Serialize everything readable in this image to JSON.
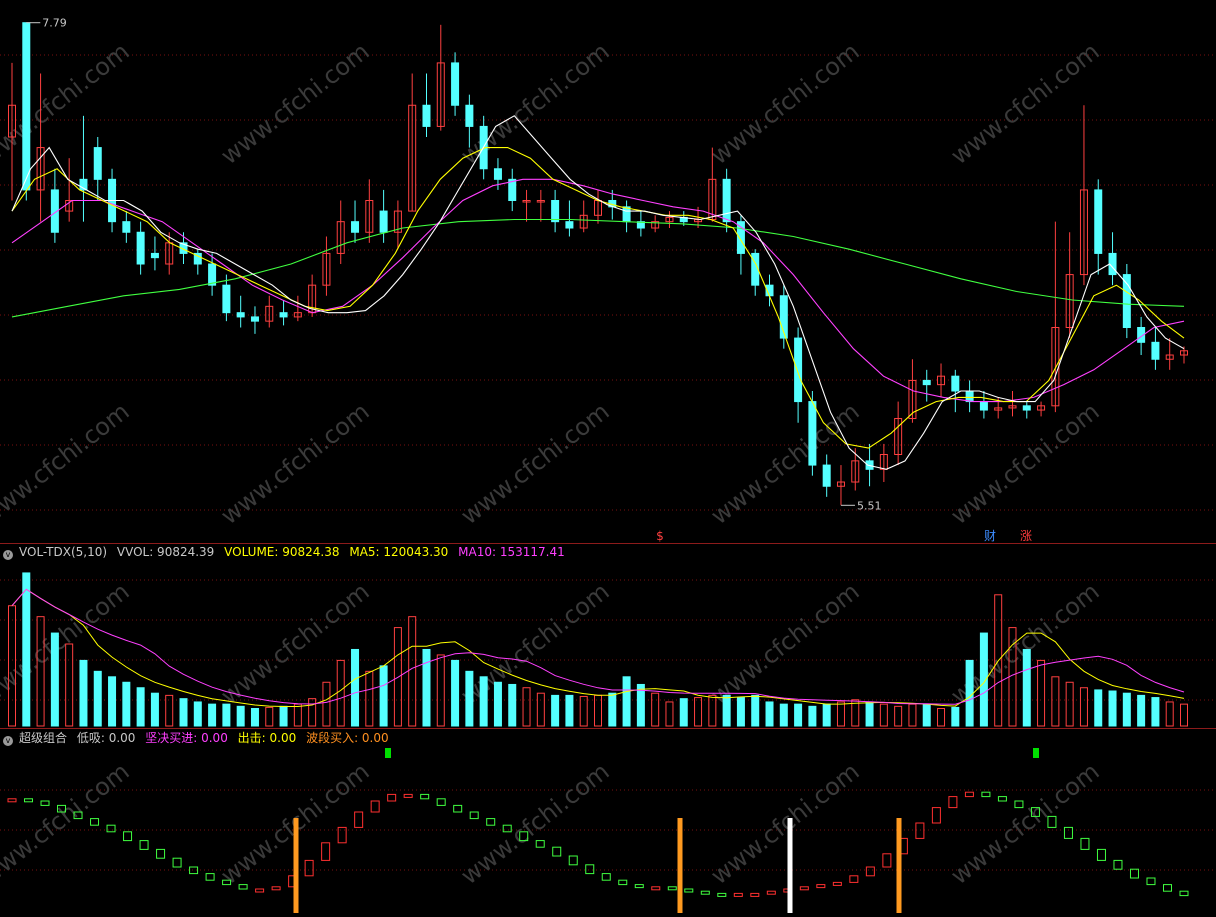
{
  "main_panel": {
    "high_label": "7.79",
    "low_label": "5.51",
    "markers": [
      {
        "text": "$",
        "color": "#ff4040"
      },
      {
        "text": "财",
        "color": "#3c8cff"
      },
      {
        "text": "涨",
        "color": "#ff3c3c"
      }
    ],
    "watermark": "www.cfchi.com"
  },
  "volume_panel": {
    "name": "VOL-TDX(5,10)",
    "items": [
      {
        "label": "VVOL: 90824.39",
        "color": "#c8c8c8"
      },
      {
        "label": "VOLUME: 90824.38",
        "color": "#ffff00"
      },
      {
        "label": "MA5: 120043.30",
        "color": "#ffff00"
      },
      {
        "label": "MA10: 153117.41",
        "color": "#ff40ff"
      }
    ]
  },
  "indicator_panel": {
    "name": "超级组合",
    "items": [
      {
        "label": "低吸: 0.00",
        "color": "#c8c8c8"
      },
      {
        "label": "坚决买进: 0.00",
        "color": "#ff40ff"
      },
      {
        "label": "出击: 0.00",
        "color": "#ffff00"
      },
      {
        "label": "波段买入: 0.00",
        "color": "#ff9020"
      }
    ]
  },
  "colors": {
    "up": "#ff4040",
    "down": "#54ffff",
    "ma_short": "#ffffff",
    "ma_mid": "#ffff00",
    "ma_long": "#ff40ff",
    "ma_trend": "#40ff40",
    "bar_orange": "#ff9a20",
    "bar_white": "#ffffff",
    "signal_green": "#00e000"
  },
  "chart_data": {
    "type": "candlestick",
    "y_range": [
      5.45,
      7.85
    ],
    "candles": [
      [
        7.25,
        7.4,
        7.6,
        6.95
      ],
      [
        7.79,
        7.0,
        7.79,
        6.95
      ],
      [
        7.0,
        7.2,
        7.55,
        6.85
      ],
      [
        7.0,
        6.8,
        7.1,
        6.75
      ],
      [
        6.9,
        6.95,
        7.15,
        6.85
      ],
      [
        7.05,
        7.0,
        7.35,
        6.85
      ],
      [
        7.2,
        7.05,
        7.25,
        6.95
      ],
      [
        7.05,
        6.85,
        7.1,
        6.8
      ],
      [
        6.85,
        6.8,
        6.9,
        6.75
      ],
      [
        6.8,
        6.65,
        6.85,
        6.6
      ],
      [
        6.7,
        6.68,
        6.78,
        6.62
      ],
      [
        6.65,
        6.75,
        6.8,
        6.6
      ],
      [
        6.75,
        6.7,
        6.8,
        6.65
      ],
      [
        6.7,
        6.65,
        6.72,
        6.6
      ],
      [
        6.65,
        6.55,
        6.7,
        6.5
      ],
      [
        6.55,
        6.42,
        6.6,
        6.38
      ],
      [
        6.42,
        6.4,
        6.5,
        6.35
      ],
      [
        6.4,
        6.38,
        6.45,
        6.32
      ],
      [
        6.38,
        6.45,
        6.5,
        6.35
      ],
      [
        6.42,
        6.4,
        6.48,
        6.36
      ],
      [
        6.4,
        6.42,
        6.5,
        6.38
      ],
      [
        6.42,
        6.55,
        6.6,
        6.4
      ],
      [
        6.55,
        6.7,
        6.78,
        6.5
      ],
      [
        6.7,
        6.85,
        6.95,
        6.65
      ],
      [
        6.85,
        6.8,
        6.95,
        6.75
      ],
      [
        6.8,
        6.95,
        7.05,
        6.75
      ],
      [
        6.9,
        6.8,
        7.0,
        6.75
      ],
      [
        6.8,
        6.9,
        6.95,
        6.72
      ],
      [
        6.9,
        7.4,
        7.55,
        6.9
      ],
      [
        7.4,
        7.3,
        7.55,
        7.25
      ],
      [
        7.3,
        7.6,
        7.78,
        7.28
      ],
      [
        7.6,
        7.4,
        7.65,
        7.35
      ],
      [
        7.4,
        7.3,
        7.45,
        7.2
      ],
      [
        7.3,
        7.1,
        7.35,
        7.05
      ],
      [
        7.1,
        7.05,
        7.15,
        7.0
      ],
      [
        7.05,
        6.95,
        7.1,
        6.9
      ],
      [
        6.95,
        6.95,
        7.0,
        6.85
      ],
      [
        6.95,
        6.95,
        7.0,
        6.85
      ],
      [
        6.95,
        6.85,
        7.0,
        6.8
      ],
      [
        6.85,
        6.82,
        6.95,
        6.78
      ],
      [
        6.82,
        6.88,
        6.95,
        6.8
      ],
      [
        6.88,
        6.95,
        7.0,
        6.84
      ],
      [
        6.95,
        6.92,
        7.0,
        6.86
      ],
      [
        6.92,
        6.85,
        6.95,
        6.8
      ],
      [
        6.85,
        6.82,
        6.9,
        6.78
      ],
      [
        6.82,
        6.85,
        6.88,
        6.8
      ],
      [
        6.85,
        6.87,
        6.9,
        6.82
      ],
      [
        6.87,
        6.85,
        6.9,
        6.83
      ],
      [
        6.85,
        6.86,
        6.92,
        6.82
      ],
      [
        6.86,
        7.05,
        7.2,
        6.85
      ],
      [
        7.05,
        6.85,
        7.1,
        6.8
      ],
      [
        6.85,
        6.7,
        6.88,
        6.6
      ],
      [
        6.7,
        6.55,
        6.72,
        6.5
      ],
      [
        6.55,
        6.5,
        6.6,
        6.45
      ],
      [
        6.5,
        6.3,
        6.55,
        6.25
      ],
      [
        6.3,
        6.0,
        6.35,
        5.9
      ],
      [
        6.0,
        5.7,
        6.05,
        5.65
      ],
      [
        5.7,
        5.6,
        5.75,
        5.55
      ],
      [
        5.6,
        5.62,
        5.7,
        5.51
      ],
      [
        5.62,
        5.72,
        5.78,
        5.58
      ],
      [
        5.72,
        5.68,
        5.8,
        5.6
      ],
      [
        5.68,
        5.75,
        5.8,
        5.62
      ],
      [
        5.75,
        5.92,
        6.0,
        5.7
      ],
      [
        5.92,
        6.1,
        6.2,
        5.9
      ],
      [
        6.1,
        6.08,
        6.15,
        6.0
      ],
      [
        6.08,
        6.12,
        6.18,
        6.02
      ],
      [
        6.12,
        6.05,
        6.15,
        5.95
      ],
      [
        6.05,
        6.0,
        6.1,
        5.95
      ],
      [
        6.0,
        5.96,
        6.05,
        5.92
      ],
      [
        5.96,
        5.97,
        6.02,
        5.92
      ],
      [
        5.97,
        5.98,
        6.05,
        5.93
      ],
      [
        5.98,
        5.96,
        6.0,
        5.92
      ],
      [
        5.96,
        5.98,
        6.0,
        5.93
      ],
      [
        5.98,
        6.35,
        6.85,
        5.95
      ],
      [
        6.35,
        6.6,
        6.8,
        6.3
      ],
      [
        6.6,
        7.0,
        7.4,
        6.55
      ],
      [
        7.0,
        6.7,
        7.05,
        6.6
      ],
      [
        6.7,
        6.6,
        6.8,
        6.55
      ],
      [
        6.6,
        6.35,
        6.65,
        6.3
      ],
      [
        6.35,
        6.28,
        6.4,
        6.22
      ],
      [
        6.28,
        6.2,
        6.35,
        6.15
      ],
      [
        6.2,
        6.22,
        6.3,
        6.15
      ],
      [
        6.22,
        6.24,
        6.26,
        6.18
      ]
    ],
    "ma_values": {
      "ma5": [
        6.9,
        7.1,
        7.2,
        7.05,
        7.0,
        6.95,
        6.95,
        6.9,
        6.8,
        6.75,
        6.72,
        6.7,
        6.65,
        6.6,
        6.55,
        6.48,
        6.44,
        6.42,
        6.42,
        6.43,
        6.5,
        6.6,
        6.72,
        6.85,
        7.0,
        7.15,
        7.3,
        7.35,
        7.25,
        7.15,
        7.05,
        6.98,
        6.93,
        6.9,
        6.9,
        6.88,
        6.87,
        6.86,
        6.88,
        6.9,
        6.8,
        6.65,
        6.45,
        6.2,
        5.95,
        5.78,
        5.7,
        5.68,
        5.72,
        5.85,
        6.0,
        6.05,
        6.05,
        6.02,
        6.0,
        6.0,
        6.1,
        6.35,
        6.6,
        6.65,
        6.55,
        6.4,
        6.3,
        6.25
      ],
      "ma10": [
        6.9,
        7.05,
        7.1,
        7.0,
        6.95,
        6.9,
        6.85,
        6.75,
        6.7,
        6.65,
        6.6,
        6.55,
        6.5,
        6.45,
        6.43,
        6.45,
        6.55,
        6.7,
        6.9,
        7.05,
        7.15,
        7.2,
        7.2,
        7.15,
        7.05,
        7.0,
        6.95,
        6.92,
        6.9,
        6.88,
        6.88,
        6.86,
        6.82,
        6.65,
        6.4,
        6.1,
        5.9,
        5.8,
        5.78,
        5.85,
        5.95,
        6.0,
        6.02,
        6.02,
        6.0,
        6.0,
        6.1,
        6.3,
        6.5,
        6.55,
        6.48,
        6.38,
        6.3
      ],
      "ma20": [
        6.75,
        6.85,
        6.95,
        6.95,
        6.9,
        6.85,
        6.75,
        6.65,
        6.55,
        6.48,
        6.42,
        6.45,
        6.55,
        6.68,
        6.82,
        6.95,
        7.02,
        7.05,
        7.05,
        7.02,
        6.98,
        6.95,
        6.92,
        6.9,
        6.85,
        6.75,
        6.6,
        6.42,
        6.25,
        6.12,
        6.05,
        6.02,
        6.0,
        6.0,
        6.02,
        6.08,
        6.15,
        6.25,
        6.35,
        6.38
      ],
      "ma60": [
        6.4,
        6.45,
        6.5,
        6.53,
        6.58,
        6.65,
        6.75,
        6.82,
        6.85,
        6.86,
        6.86,
        6.85,
        6.84,
        6.82,
        6.78,
        6.72,
        6.65,
        6.58,
        6.52,
        6.48,
        6.46,
        6.45
      ]
    },
    "volume": [
      110,
      140,
      100,
      85,
      75,
      60,
      50,
      45,
      40,
      35,
      30,
      28,
      25,
      22,
      20,
      20,
      18,
      16,
      17,
      18,
      20,
      25,
      40,
      60,
      70,
      50,
      55,
      90,
      100,
      70,
      65,
      60,
      50,
      45,
      40,
      38,
      35,
      30,
      28,
      28,
      27,
      28,
      30,
      45,
      38,
      30,
      22,
      25,
      26,
      28,
      28,
      26,
      28,
      22,
      20,
      20,
      18,
      20,
      22,
      24,
      22,
      20,
      18,
      20,
      20,
      16,
      17,
      60,
      85,
      120,
      90,
      70,
      60,
      45,
      40,
      35,
      33,
      32,
      30,
      28,
      26,
      22,
      20
    ],
    "volume_ylim": [
      0,
      150
    ],
    "indicator": [
      0.92,
      0.9,
      0.86,
      0.8,
      0.74,
      0.68,
      0.62,
      0.54,
      0.46,
      0.38,
      0.3,
      0.24,
      0.18,
      0.14,
      0.1,
      0.1,
      0.12,
      0.22,
      0.36,
      0.52,
      0.66,
      0.8,
      0.9,
      0.96,
      0.96,
      0.92,
      0.86,
      0.8,
      0.74,
      0.68,
      0.62,
      0.54,
      0.48,
      0.4,
      0.32,
      0.24,
      0.18,
      0.14,
      0.12,
      0.12,
      0.1,
      0.08,
      0.06,
      0.05,
      0.06,
      0.06,
      0.08,
      0.1,
      0.12,
      0.14,
      0.16,
      0.22,
      0.3,
      0.42,
      0.56,
      0.7,
      0.84,
      0.94,
      0.98,
      0.94,
      0.9,
      0.84,
      0.76,
      0.66,
      0.56,
      0.46,
      0.36,
      0.28,
      0.2,
      0.14,
      0.08,
      0.04
    ],
    "indicator_ylim": [
      0,
      1
    ]
  }
}
